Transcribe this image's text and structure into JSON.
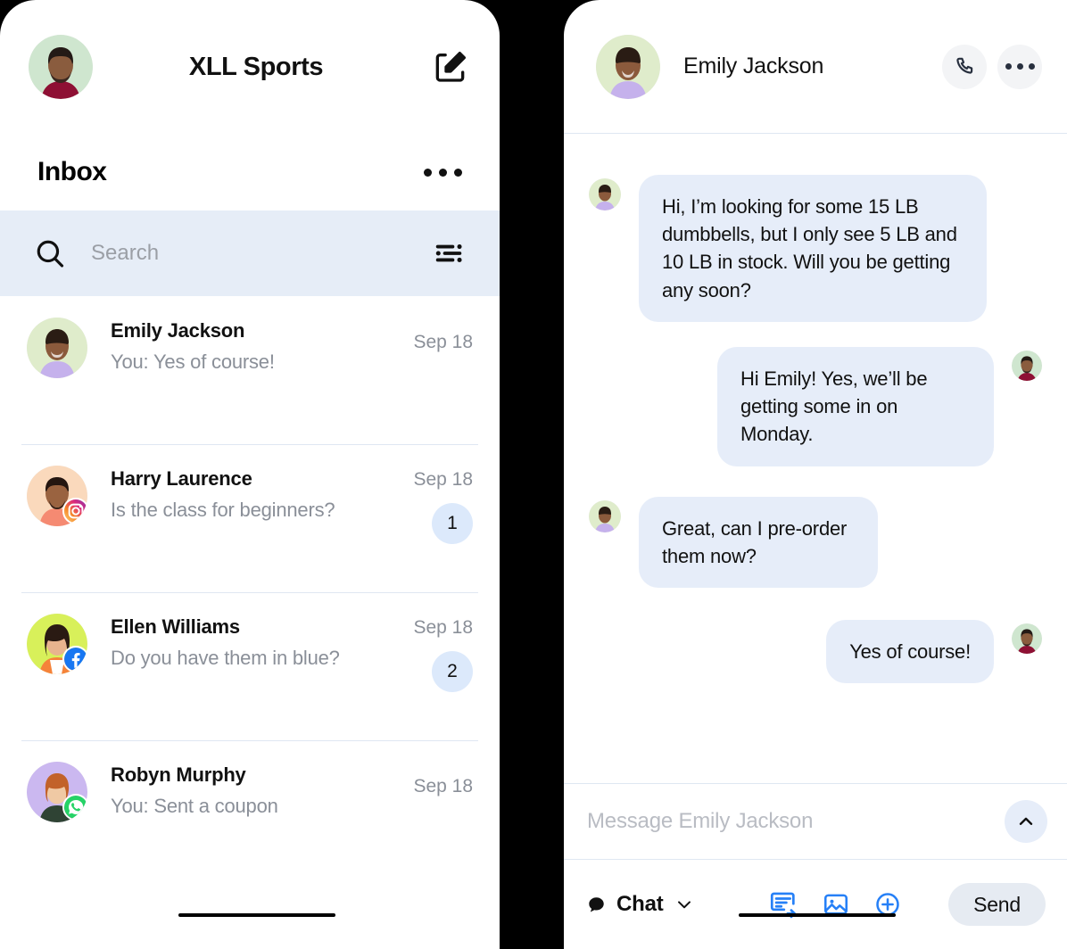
{
  "left_panel": {
    "header": {
      "brand_title": "XLL Sports",
      "account_avatar_name": "account-avatar",
      "compose_icon": "compose-icon"
    },
    "inbox": {
      "title": "Inbox",
      "more_icon": "more-options-icon"
    },
    "search": {
      "placeholder": "Search",
      "value": "",
      "search_icon": "search-icon",
      "filter_icon": "filter-sort-icon"
    },
    "conversations": [
      {
        "name": "Emily Jackson",
        "preview": "You: Yes of course!",
        "date": "Sep 18",
        "unread": "",
        "channel": "none"
      },
      {
        "name": "Harry Laurence",
        "preview": "Is the class for beginners?",
        "date": "Sep 18",
        "unread": "1",
        "channel": "instagram"
      },
      {
        "name": "Ellen Williams",
        "preview": "Do you have them in blue?",
        "date": "Sep 18",
        "unread": "2",
        "channel": "facebook"
      },
      {
        "name": "Robyn Murphy",
        "preview": "You: Sent a coupon",
        "date": "Sep 18",
        "unread": "",
        "channel": "whatsapp"
      }
    ]
  },
  "right_panel": {
    "header": {
      "contact_name": "Emily Jackson",
      "call_icon": "phone-icon",
      "more_icon": "more-options-icon"
    },
    "messages": [
      {
        "direction": "in",
        "text": "Hi, I’m looking for some 15 LB dumbbells, but I only see 5 LB and 10 LB in stock. Will you be getting any soon?"
      },
      {
        "direction": "out",
        "text": "Hi Emily! Yes, we’ll be getting some in on Monday."
      },
      {
        "direction": "in",
        "text": "Great, can I pre-order them now?"
      },
      {
        "direction": "out",
        "text": "Yes of course!"
      }
    ],
    "composer": {
      "placeholder": "Message Emily Jackson",
      "value": "",
      "expand_icon": "chevron-up-icon",
      "channel_label": "Chat",
      "channel_icon": "chat-bubble-icon",
      "channel_chevron": "chevron-down-icon",
      "tools": [
        {
          "icon": "quick-reply-icon"
        },
        {
          "icon": "image-icon"
        },
        {
          "icon": "add-plus-icon"
        }
      ],
      "send_label": "Send"
    }
  },
  "colors": {
    "bubble": "#e6edf9",
    "search_bar": "#e6edf7",
    "badge": "#dce9fb",
    "accent_blue": "#2680f7",
    "muted_text": "#8a8f98",
    "divider": "#dfe7f2"
  }
}
